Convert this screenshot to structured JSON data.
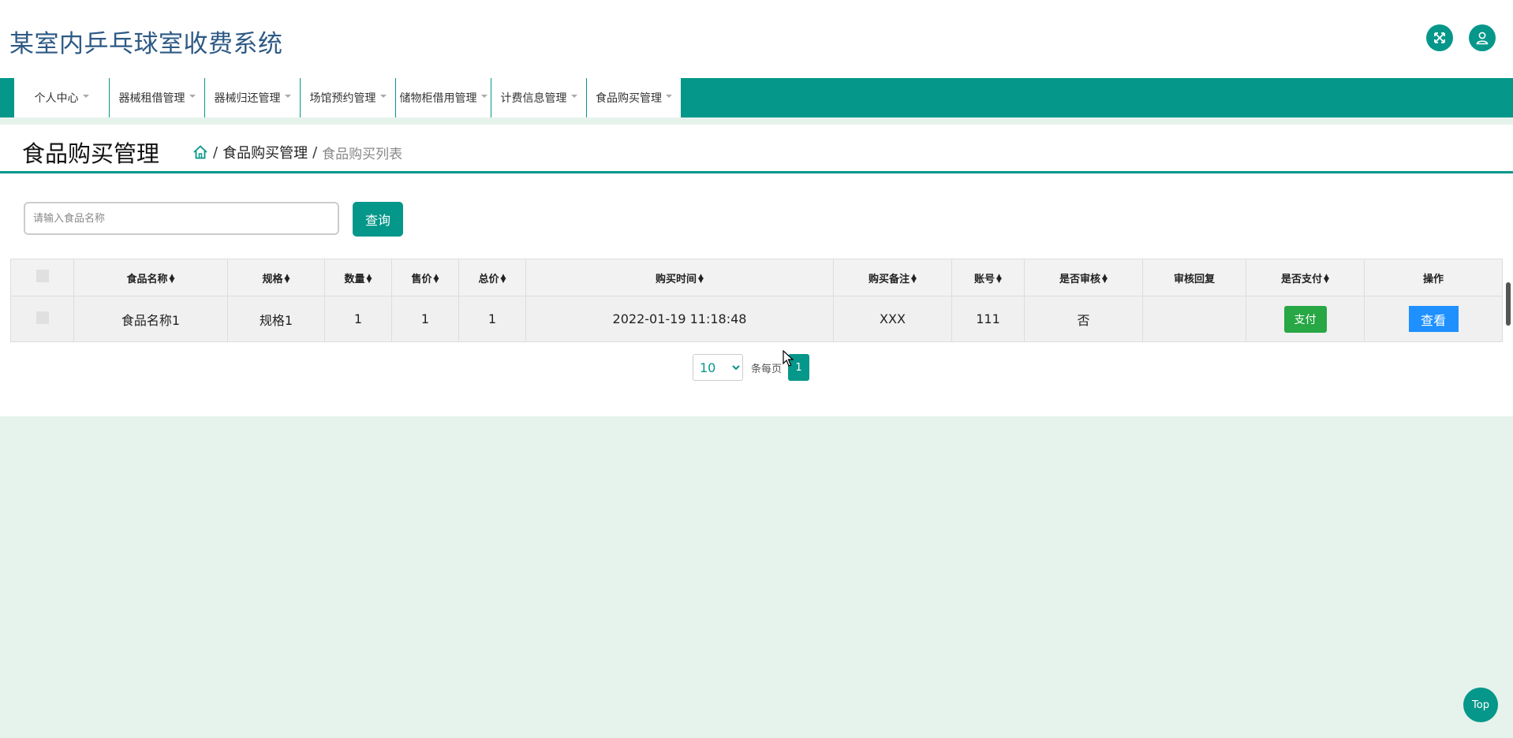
{
  "app": {
    "title": "某室内乒乓球室收费系统"
  },
  "nav": {
    "items": [
      {
        "label": "个人中心"
      },
      {
        "label": "器械租借管理"
      },
      {
        "label": "器械归还管理"
      },
      {
        "label": "场馆预约管理"
      },
      {
        "label": "储物柜借用管理"
      },
      {
        "label": "计费信息管理"
      },
      {
        "label": "食品购买管理"
      }
    ]
  },
  "page": {
    "title": "食品购买管理",
    "breadcrumb": {
      "parent": "食品购买管理",
      "current": "食品购买列表"
    }
  },
  "search": {
    "placeholder": "请输入食品名称",
    "button_label": "查询"
  },
  "table": {
    "columns": [
      "食品名称",
      "规格",
      "数量",
      "售价",
      "总价",
      "购买时间",
      "购买备注",
      "账号",
      "是否审核",
      "审核回复",
      "是否支付",
      "操作"
    ],
    "rows": [
      {
        "name": "食品名称1",
        "spec": "规格1",
        "qty": "1",
        "price": "1",
        "total": "1",
        "time": "2022-01-19 11:18:48",
        "note": "XXX",
        "account": "111",
        "reviewed": "否",
        "reply": "",
        "pay_label": "支付",
        "view_label": "查看"
      }
    ]
  },
  "pagination": {
    "page_size": "10",
    "per_page_label": "条每页",
    "current_page": "1"
  },
  "back_to_top": "Top",
  "colors": {
    "primary": "#05978a",
    "title": "#2e5a85",
    "pay": "#28a745",
    "view": "#1e90ff",
    "background": "#e6f2ec"
  }
}
